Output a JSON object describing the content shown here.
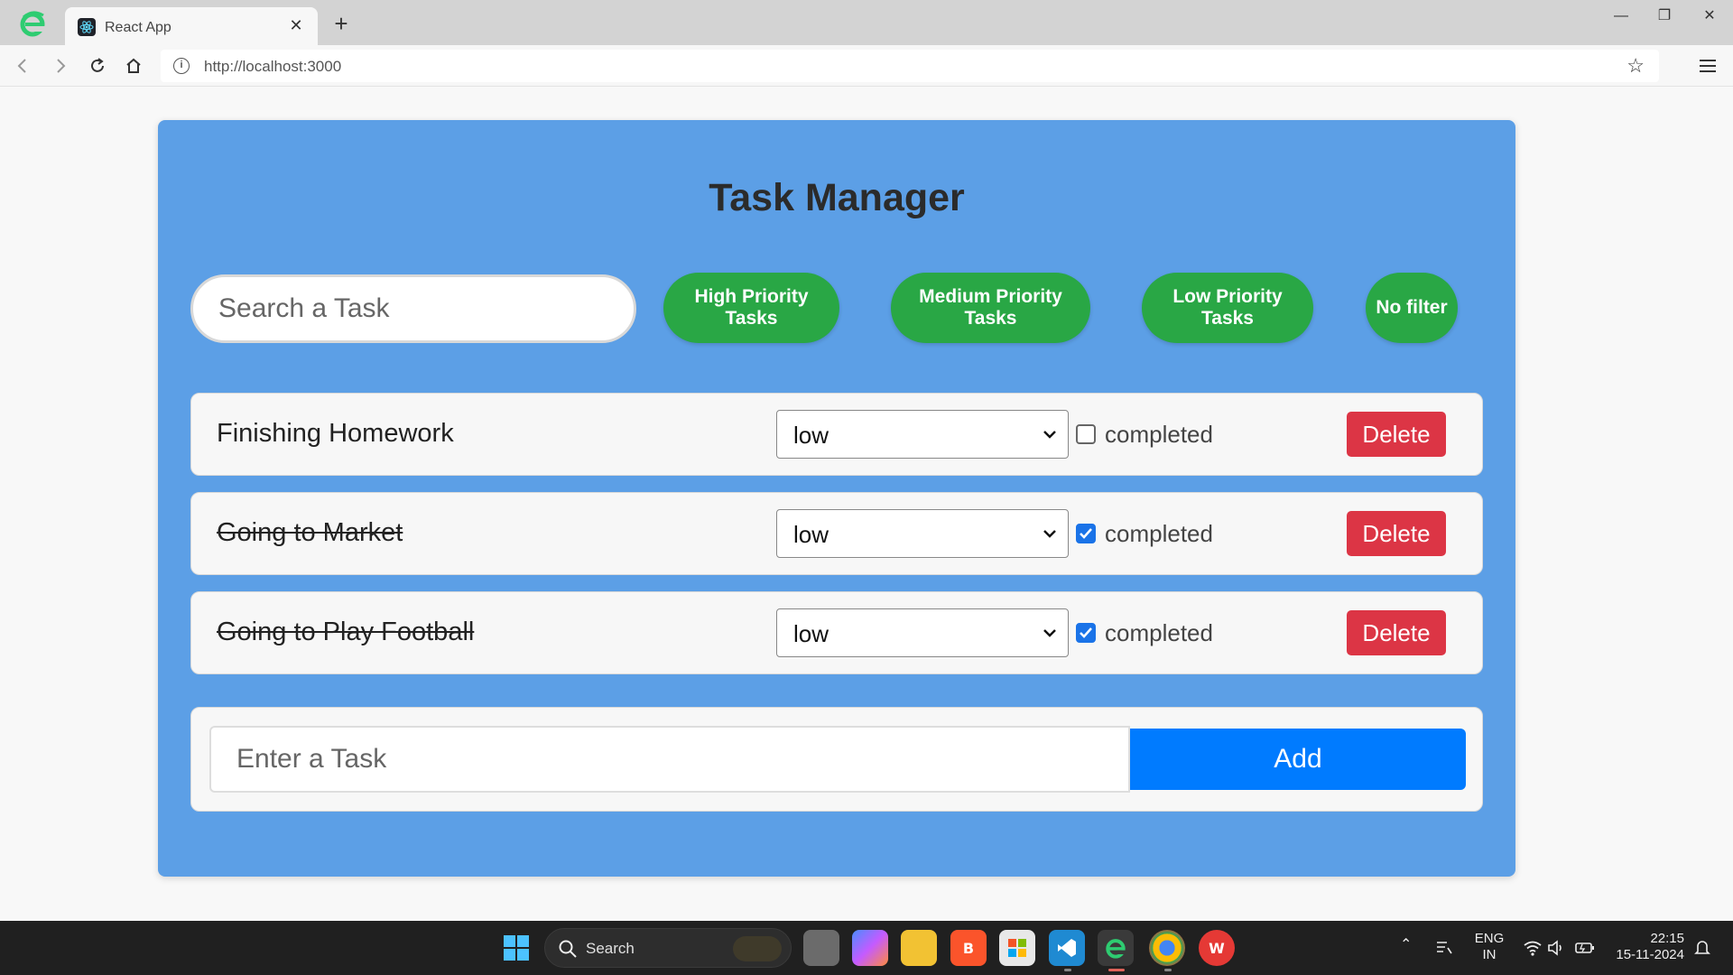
{
  "browser": {
    "tab_title": "React App",
    "url": "http://localhost:3000",
    "info_icon_glyph": "i"
  },
  "app": {
    "title": "Task Manager",
    "search_placeholder": "Search a Task",
    "filters": [
      {
        "label": "High Priority Tasks"
      },
      {
        "label": "Medium Priority Tasks"
      },
      {
        "label": "Low Priority Tasks"
      },
      {
        "label": "No filter"
      }
    ],
    "tasks": [
      {
        "name": "Finishing Homework",
        "priority": "low",
        "completed": false,
        "completed_label": "completed",
        "delete_label": "Delete"
      },
      {
        "name": "Going to Market",
        "priority": "low",
        "completed": true,
        "completed_label": "completed",
        "delete_label": "Delete"
      },
      {
        "name": "Going to Play Football",
        "priority": "low",
        "completed": true,
        "completed_label": "completed",
        "delete_label": "Delete"
      }
    ],
    "add_placeholder": "Enter a Task",
    "add_label": "Add"
  },
  "taskbar": {
    "search_label": "Search",
    "language_line1": "ENG",
    "language_line2": "IN",
    "time": "22:15",
    "date": "15-11-2024"
  },
  "colors": {
    "card_bg": "#5c9fe6",
    "filter_green": "#29a745",
    "delete_red": "#dc3545",
    "add_blue": "#007bff",
    "checkbox_blue": "#1a73e8"
  }
}
